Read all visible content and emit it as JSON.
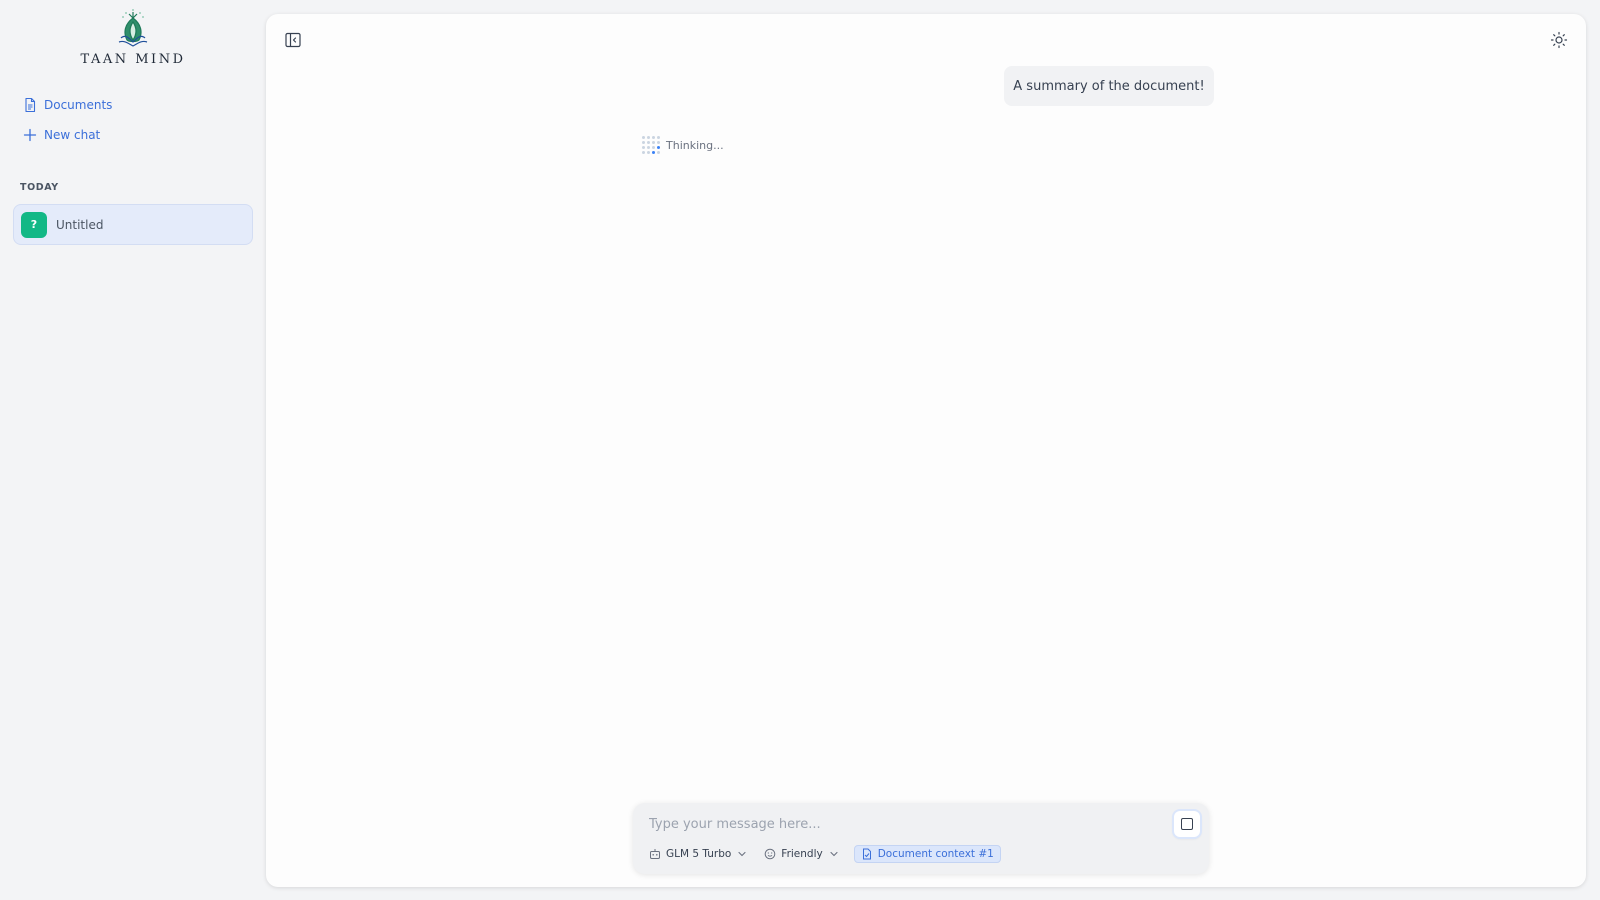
{
  "app": {
    "logo_text": "TAAN MIND"
  },
  "sidebar": {
    "nav": [
      {
        "label": "Documents",
        "icon": "document-icon"
      },
      {
        "label": "New chat",
        "icon": "plus-icon"
      }
    ],
    "section_label": "TODAY",
    "chats": [
      {
        "title": "Untitled",
        "avatar_glyph": "?",
        "avatar_color": "#12b886"
      }
    ]
  },
  "conversation": {
    "messages": [
      {
        "role": "user",
        "text": "A summary of the document!"
      }
    ],
    "status": "Thinking..."
  },
  "composer": {
    "placeholder": "Type your message here...",
    "model": "GLM 5 Turbo",
    "tone": "Friendly",
    "context_chip": "Document context #1"
  },
  "colors": {
    "accent": "#3b6fd9",
    "active_chat_bg": "#e4ebfa",
    "avatar": "#12b886"
  }
}
